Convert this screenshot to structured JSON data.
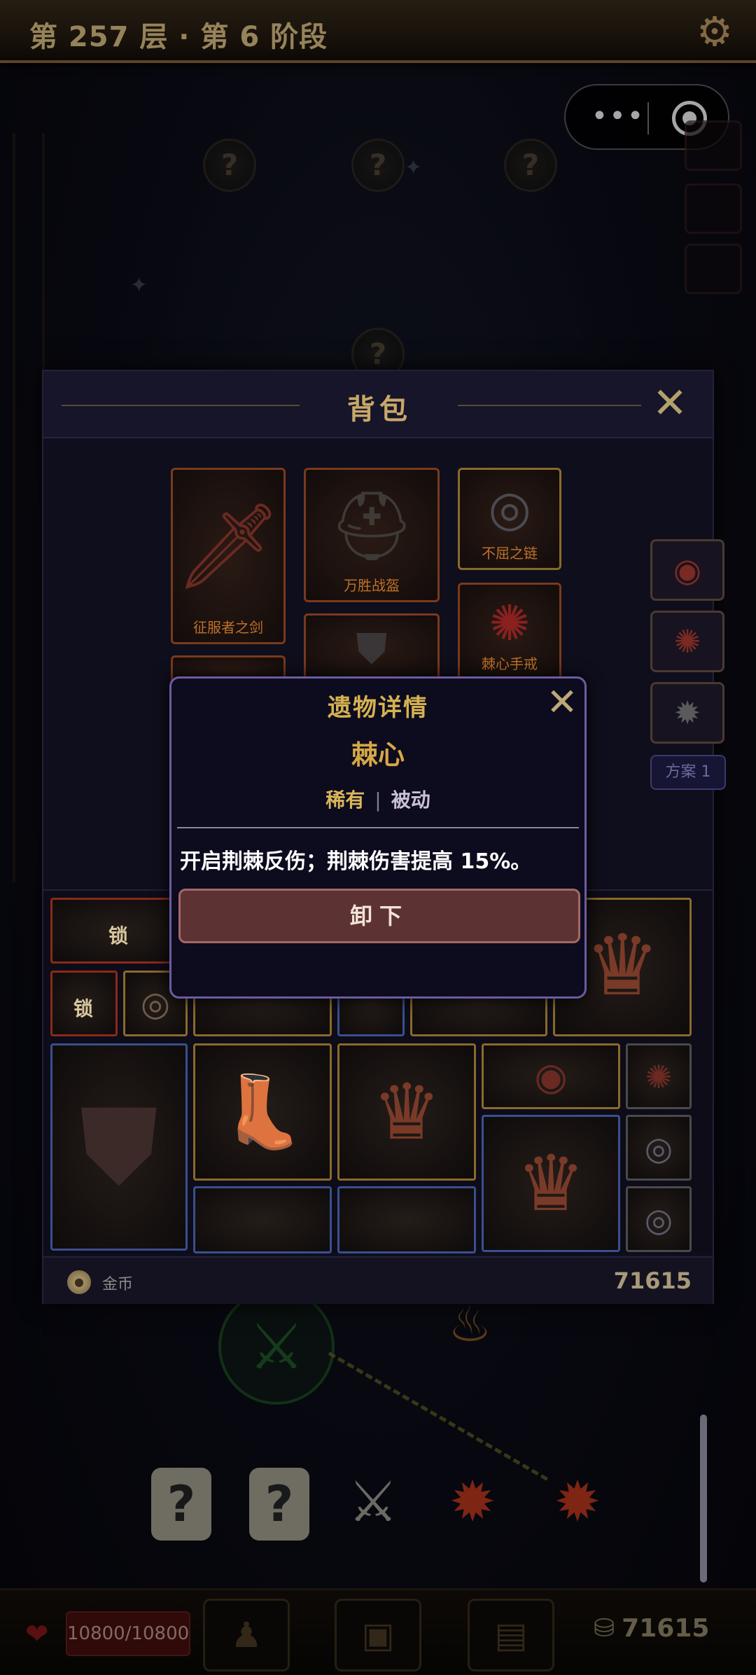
{
  "header": {
    "floor_title": "第 257 层 · 第 6 阶段"
  },
  "map": {
    "unknown_node_symbol": "?",
    "bottom_nodes": [
      "?",
      "?",
      "⚔",
      "✹",
      "✹"
    ]
  },
  "backpack": {
    "title": "背包",
    "equipped": [
      {
        "name": "征服者之剑",
        "icon": "sword-icon"
      },
      {
        "name": "万胜战盔",
        "icon": "helmet-icon"
      },
      {
        "name": "不屈之链",
        "icon": "necklace-icon"
      },
      {
        "name": "棘心手戒",
        "icon": "ring-icon"
      }
    ],
    "plan_label": "方案 1",
    "lock_label": "锁",
    "footer": {
      "currency_label": "金币",
      "currency_value": "71615"
    }
  },
  "relic_dialog": {
    "title": "遗物详情",
    "name": "棘心",
    "rarity": "稀有",
    "separator": "|",
    "type": "被动",
    "description": "开启荆棘反伤；荆棘伤害提高 15%。",
    "unequip_label": "卸下"
  },
  "hud": {
    "hp": "10800/10800",
    "gold": "71615"
  },
  "colors": {
    "accent_gold": "#d5b251",
    "dialog_border": "#6b5ca0",
    "button_red": "#5c3232"
  }
}
